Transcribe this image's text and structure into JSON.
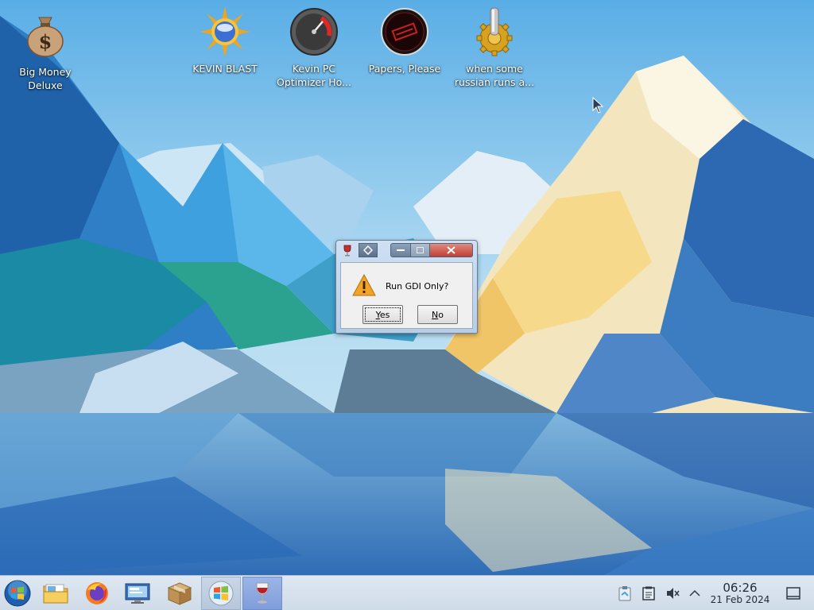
{
  "desktop": {
    "icons": [
      {
        "label": "Big Money\nDeluxe",
        "icon": "money-bag-icon"
      },
      {
        "label": "KEVIN BLAST",
        "icon": "sun-orb-icon"
      },
      {
        "label": "Kevin PC\nOptimizer Ho...",
        "icon": "speedometer-icon"
      },
      {
        "label": "Papers, Please",
        "icon": "stamp-seal-icon"
      },
      {
        "label": "when some\nrussian runs a...",
        "icon": "gear-icon"
      }
    ]
  },
  "dialog": {
    "message": "Run GDI Only?",
    "yes_label": "es",
    "yes_mnemonic": "Y",
    "no_label": "o",
    "no_mnemonic": "N",
    "icon": "warning-icon"
  },
  "taskbar": {
    "start_icon": "start-orb-icon",
    "items": [
      {
        "name": "file-manager",
        "icon": "folder-icon",
        "state": "pinned"
      },
      {
        "name": "firefox",
        "icon": "firefox-icon",
        "state": "pinned"
      },
      {
        "name": "remote-desktop",
        "icon": "monitor-icon",
        "state": "pinned"
      },
      {
        "name": "package",
        "icon": "package-box-icon",
        "state": "pinned"
      },
      {
        "name": "windows",
        "icon": "windows-logo-icon",
        "state": "open"
      },
      {
        "name": "wine",
        "icon": "wine-glass-icon",
        "state": "active"
      }
    ],
    "tray": [
      "clipboard-icon",
      "notes-icon",
      "volume-muted-icon",
      "chevron-up-icon"
    ],
    "time": "06:26",
    "date": "21 Feb 2024",
    "show_desktop_icon": "show-desktop-icon"
  },
  "colors": {
    "taskbar_bg": "#d6e1ec",
    "active_item": "#8fa9df",
    "close_button": "#c9463d"
  }
}
